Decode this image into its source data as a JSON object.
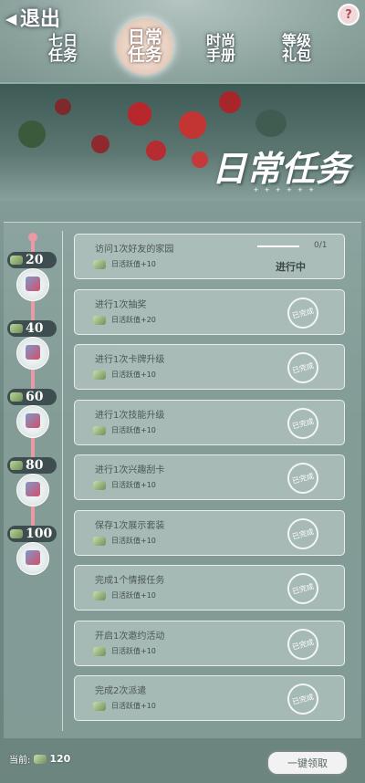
{
  "header": {
    "back_label": "退出",
    "help_label": "?"
  },
  "tabs": [
    {
      "label_top": "七日",
      "label_bottom": "任务",
      "active": false
    },
    {
      "label_top": "日常",
      "label_bottom": "任务",
      "active": true
    },
    {
      "label_top": "时尚",
      "label_bottom": "手册",
      "active": false
    },
    {
      "label_top": "等级",
      "label_bottom": "礼包",
      "active": false
    }
  ],
  "banner": {
    "title": "日常任务",
    "stars": "+ + + + + +"
  },
  "milestones": [
    {
      "value": "20"
    },
    {
      "value": "40"
    },
    {
      "value": "60"
    },
    {
      "value": "80"
    },
    {
      "value": "100"
    }
  ],
  "tasks": [
    {
      "title": "访问1次好友的家园",
      "reward": "日活跃值+10",
      "progress_text": "0/1",
      "progress": 0,
      "status": "进行中"
    },
    {
      "title": "进行1次抽奖",
      "reward": "日活跃值+20",
      "stamp": "已完成"
    },
    {
      "title": "进行1次卡牌升级",
      "reward": "日活跃值+10",
      "stamp": "已完成"
    },
    {
      "title": "进行1次技能升级",
      "reward": "日活跃值+10",
      "stamp": "已完成"
    },
    {
      "title": "进行1次兴趣刮卡",
      "reward": "日活跃值+10",
      "stamp": "已完成"
    },
    {
      "title": "保存1次展示套装",
      "reward": "日活跃值+10",
      "stamp": "已完成"
    },
    {
      "title": "完成1个情报任务",
      "reward": "日活跃值+10",
      "stamp": "已完成"
    },
    {
      "title": "开启1次邀约活动",
      "reward": "日活跃值+10",
      "stamp": "已完成"
    },
    {
      "title": "完成2次派遣",
      "reward": "日活跃值+10",
      "stamp": "已完成"
    }
  ],
  "footer": {
    "current_label": "当前:",
    "current_value": "120",
    "claim_label": "一键领取"
  },
  "colors": {
    "accent_pink": "#e99aa6",
    "panel": "#96ada8"
  }
}
